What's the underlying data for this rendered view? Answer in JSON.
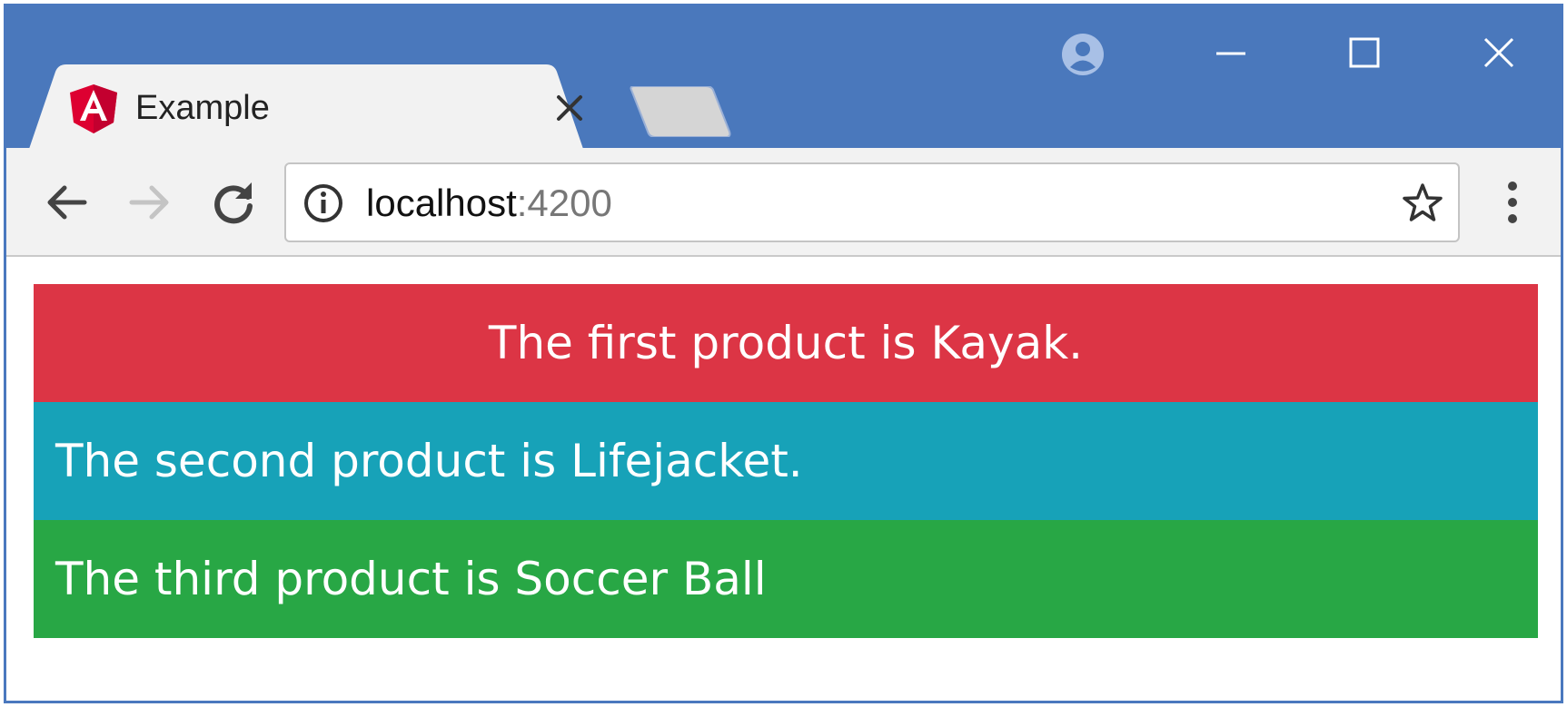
{
  "browser": {
    "tab": {
      "title": "Example",
      "favicon": "angular-logo-icon"
    },
    "window_controls": [
      "profile-icon",
      "minimize-icon",
      "maximize-icon",
      "close-icon"
    ],
    "address_bar": {
      "host": "localhost",
      "port": ":4200"
    },
    "colors": {
      "titlebar": "#4a78bc",
      "toolbar": "#f2f2f2"
    }
  },
  "page": {
    "products": [
      {
        "text": "The first product is Kayak.",
        "color": "#dc3545",
        "align": "center"
      },
      {
        "text": "The second product is Lifejacket.",
        "color": "#17a2b8",
        "align": "left"
      },
      {
        "text": "The third product is Soccer Ball",
        "color": "#28a745",
        "align": "left"
      }
    ]
  }
}
